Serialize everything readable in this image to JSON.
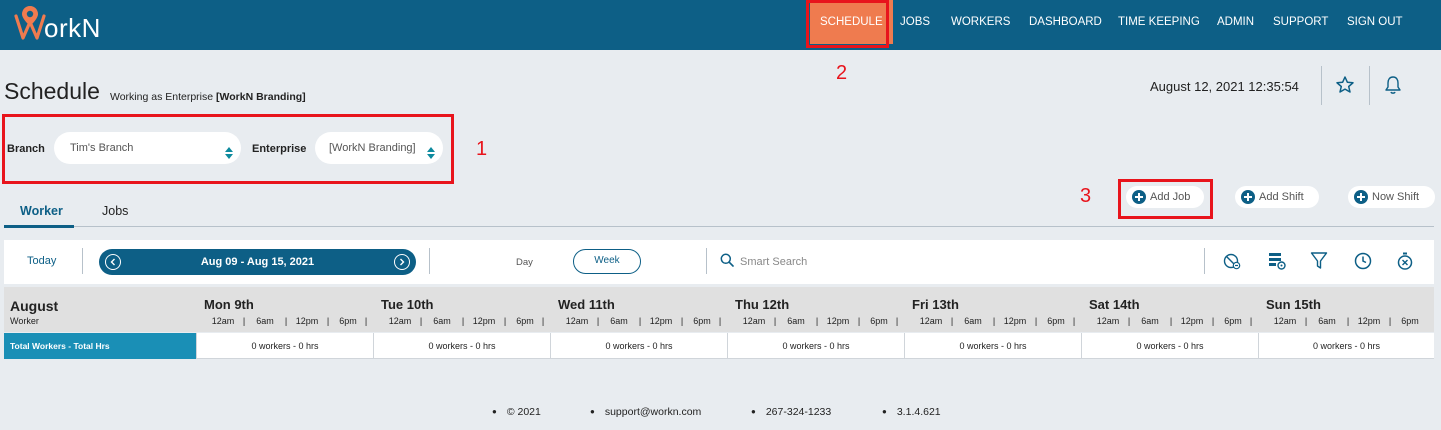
{
  "brand": {
    "name": "orkN",
    "accent": "#ef7b4f",
    "primary": "#0d5f86",
    "row_label_color": "#1a8fb6"
  },
  "nav": {
    "items": [
      {
        "label": "SCHEDULE",
        "active": true
      },
      {
        "label": "JOBS"
      },
      {
        "label": "WORKERS"
      },
      {
        "label": "DASHBOARD"
      },
      {
        "label": "TIME KEEPING"
      },
      {
        "label": "ADMIN"
      },
      {
        "label": "SUPPORT"
      },
      {
        "label": "SIGN OUT"
      }
    ]
  },
  "annotations": {
    "one": "1",
    "two": "2",
    "three": "3"
  },
  "header": {
    "title": "Schedule",
    "subtitle_prefix": "Working as Enterprise ",
    "subtitle_bold": "[WorkN Branding]",
    "datetime": "August 12, 2021 12:35:54",
    "icons": [
      "star-icon",
      "bell-icon"
    ]
  },
  "filters": {
    "branch_label": "Branch",
    "branch_value": "Tim's Branch",
    "enterprise_label": "Enterprise",
    "enterprise_value": "[WorkN Branding]"
  },
  "tabs": [
    {
      "label": "Worker",
      "active": true
    },
    {
      "label": "Jobs"
    }
  ],
  "actions": {
    "add_job": "Add Job",
    "add_shift": "Add Shift",
    "now_shift": "Now Shift"
  },
  "toolbar": {
    "today": "Today",
    "range": "Aug 09 - Aug 15, 2021",
    "day": "Day",
    "week": "Week",
    "search_placeholder": "Smart Search",
    "icons": [
      "hide-icon",
      "settings-list-icon",
      "filter-icon",
      "clock-icon",
      "stopwatch-icon"
    ]
  },
  "grid": {
    "month": "August",
    "row_header": "Worker",
    "days": [
      "Mon 9th",
      "Tue 10th",
      "Wed 11th",
      "Thu 12th",
      "Fri 13th",
      "Sat 14th",
      "Sun 15th"
    ],
    "hours": [
      "12am",
      "6am",
      "12pm",
      "6pm"
    ],
    "row_label": "Total Workers - Total Hrs",
    "cells": [
      "0 workers - 0 hrs",
      "0 workers - 0 hrs",
      "0 workers - 0 hrs",
      "0 workers - 0 hrs",
      "0 workers - 0 hrs",
      "0 workers - 0 hrs",
      "0 workers - 0 hrs"
    ]
  },
  "footer": {
    "copyright": "© 2021",
    "email": "support@workn.com",
    "phone": "267-324-1233",
    "version": "3.1.4.621"
  }
}
